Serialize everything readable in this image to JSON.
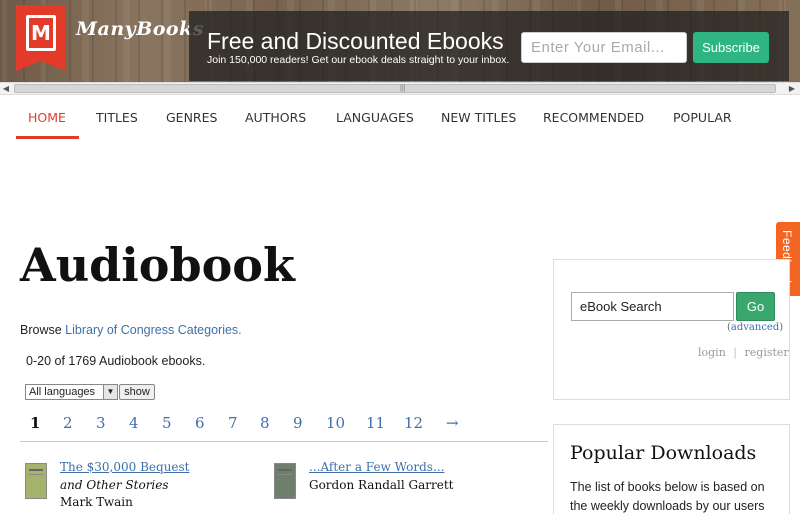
{
  "header": {
    "logo_letter": "M",
    "logo_text": "ManyBooks",
    "promo_title": "Free and Discounted Ebooks",
    "promo_subtitle": "Join 150,000 readers! Get our ebook deals straight to your inbox.",
    "email_placeholder": "Enter Your Email...",
    "subscribe_label": "Subscribe",
    "brand_color": "#e23b29",
    "subscribe_color": "#2fb583"
  },
  "nav": {
    "items": [
      {
        "label": "HOME",
        "active": true
      },
      {
        "label": "TITLES"
      },
      {
        "label": "GENRES"
      },
      {
        "label": "AUTHORS"
      },
      {
        "label": "LANGUAGES"
      },
      {
        "label": "NEW TITLES"
      },
      {
        "label": "RECOMMENDED"
      },
      {
        "label": "POPULAR"
      }
    ]
  },
  "feedback_label": "Feedback",
  "main": {
    "title": "Audiobook",
    "browse_prefix": "Browse",
    "browse_link": "Library of Congress Categories.",
    "count_text": "0-20 of 1769 Audiobook ebooks.",
    "language_selected": "All languages",
    "show_label": "show",
    "pages": [
      "1",
      "2",
      "3",
      "4",
      "5",
      "6",
      "7",
      "8",
      "9",
      "10",
      "11",
      "12"
    ],
    "current_page": "1",
    "next_arrow": "→",
    "books": [
      {
        "title": "The $30,000 Bequest",
        "subtitle": "and Other Stories",
        "author": "Mark Twain",
        "cover_color": "#a6b36c"
      },
      {
        "title": "...After a Few Words...",
        "subtitle": "",
        "author": "Gordon Randall Garrett",
        "cover_color": "#6f7f6e"
      }
    ]
  },
  "sidebar": {
    "search_value": "eBook Search",
    "go_label": "Go",
    "advanced_label": "advanced",
    "login_label": "login",
    "separator": "|",
    "register_label": "register",
    "popular_title": "Popular Downloads",
    "popular_desc": "The list of books below is based on the weekly downloads by our users"
  }
}
